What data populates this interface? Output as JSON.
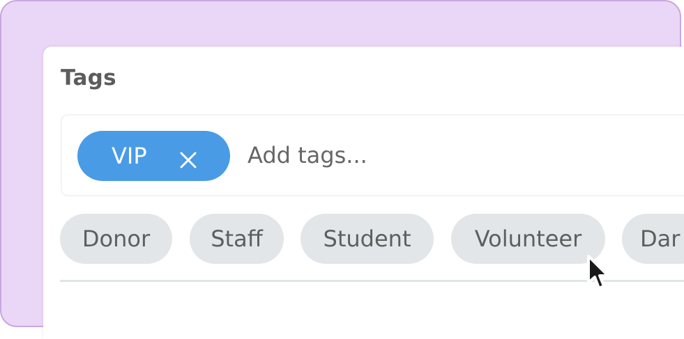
{
  "tags_panel": {
    "title": "Tags",
    "selected_tags": [
      {
        "label": "VIP",
        "remove_icon": "close-icon"
      }
    ],
    "input": {
      "placeholder": "Add tags...",
      "value": ""
    },
    "suggestions": [
      {
        "label": "Donor"
      },
      {
        "label": "Staff"
      },
      {
        "label": "Student"
      },
      {
        "label": "Volunteer"
      },
      {
        "label": "Dar"
      }
    ]
  },
  "colors": {
    "backdrop": "#ead6f7",
    "backdrop_border": "#c8a8e0",
    "selected_chip": "#4a9be6",
    "suggestion_chip": "#e2e6e9",
    "title_text": "#5c5c5c"
  },
  "pointer": {
    "icon": "mouse-pointer-icon"
  }
}
